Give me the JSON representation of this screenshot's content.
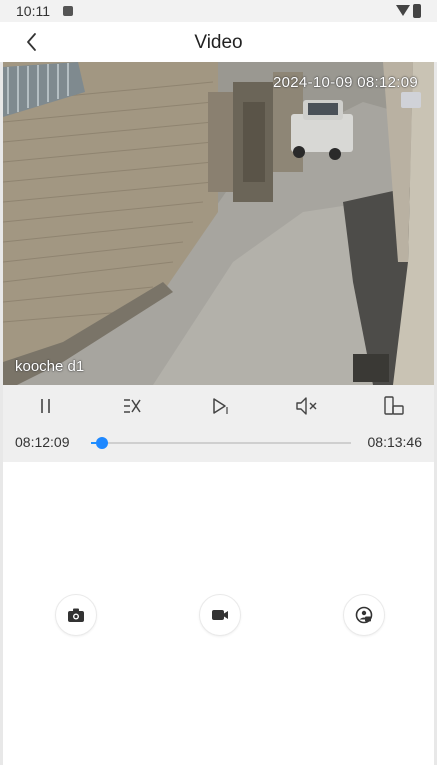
{
  "status_bar": {
    "time": "10:11"
  },
  "app_bar": {
    "title": "Video"
  },
  "video": {
    "osd_datetime": "2024-10-09 08:12:09",
    "camera_name": "kooche d1"
  },
  "playback": {
    "start_time": "08:12:09",
    "end_time": "08:13:46",
    "progress": 0.02
  },
  "icons": {
    "back": "chevron-left-icon",
    "pause": "pause-icon",
    "speed": "speed-x-icon",
    "step": "play-step-icon",
    "mute": "speaker-muted-icon",
    "rotate": "fullscreen-rotate-icon",
    "snapshot": "camera-icon",
    "record": "video-camera-icon",
    "extra": "face-lock-icon"
  },
  "colors": {
    "accent": "#1e88ff",
    "controls_bg": "#efefef"
  }
}
